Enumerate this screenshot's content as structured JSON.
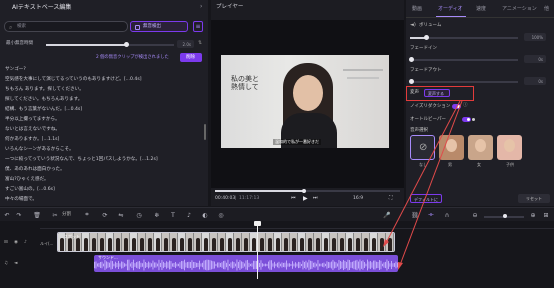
{
  "left_panel": {
    "title": "AIテキストベース編集",
    "search_placeholder": "検索",
    "detect_button": "無音検出",
    "silence_label": "最小無音時間",
    "silence_value": "2.0s",
    "clips_label": "2 個の無音クリップが検出されました",
    "delete_button": "削除",
    "transcript_lines": [
      "サンゴー?",
      "空気感を大事にして演じてるっていうのもありますけど。[...0.4s]",
      "ちもろん あります。探してください。",
      "探してください。もちろんあります。",
      "結構、もう言葉がないんだ。[...0.4s]",
      "半分以上撮ってますから。",
      "ないとは言えないですね。",
      "何かありますか。[...1.1s]",
      "いろんなシーンがあるからこそ。",
      "一つに絞ってっていう状況なんで、ちょっと1回パスしようかな。[...1.2s]",
      "僕、あのあれは面白かった。",
      "富山?ひゃくえ感だ。",
      "すごい富山の。[...0.6s]",
      "中々の場面で。"
    ]
  },
  "player": {
    "title": "プレイヤー",
    "video_text": "私の美と熱情して",
    "subtitle": "温和的で私が一番好きだ",
    "time_current": "00:40:03",
    "time_total": "11:17:13",
    "ratio": "16:9",
    "progress": 0.48
  },
  "right_panel": {
    "tabs": [
      "動画",
      "オーディオ",
      "速度",
      "アニメーション",
      "他"
    ],
    "active_tab": 1,
    "volume_label": "ボリューム",
    "volume_value": "100%",
    "volume_level": 0.15,
    "fadein_label": "フェードイン",
    "fadein_value": "0s",
    "fadeout_label": "フェードアウト",
    "fadeout_value": "0s",
    "voice_change_label": "変声",
    "voice_change_button": "変声する",
    "noise_label": "ノイズリダクション",
    "autosurfer_label": "オートルビーパー",
    "voices_label": "音声選択",
    "voices": [
      {
        "label": "なし",
        "color": "#2a2a33"
      },
      {
        "label": "男",
        "color": "#b98a6a"
      },
      {
        "label": "女",
        "color": "#c9a58a"
      },
      {
        "label": "子供",
        "color": "#e4b7a8"
      }
    ],
    "reset_button": "リセット",
    "apply_button": "デフォルトに"
  },
  "timeline": {
    "split_label": "分割",
    "tracks": {
      "video_name": "ルイ(...",
      "clip_name": "スポット",
      "audio_name": "サウンド..."
    }
  }
}
